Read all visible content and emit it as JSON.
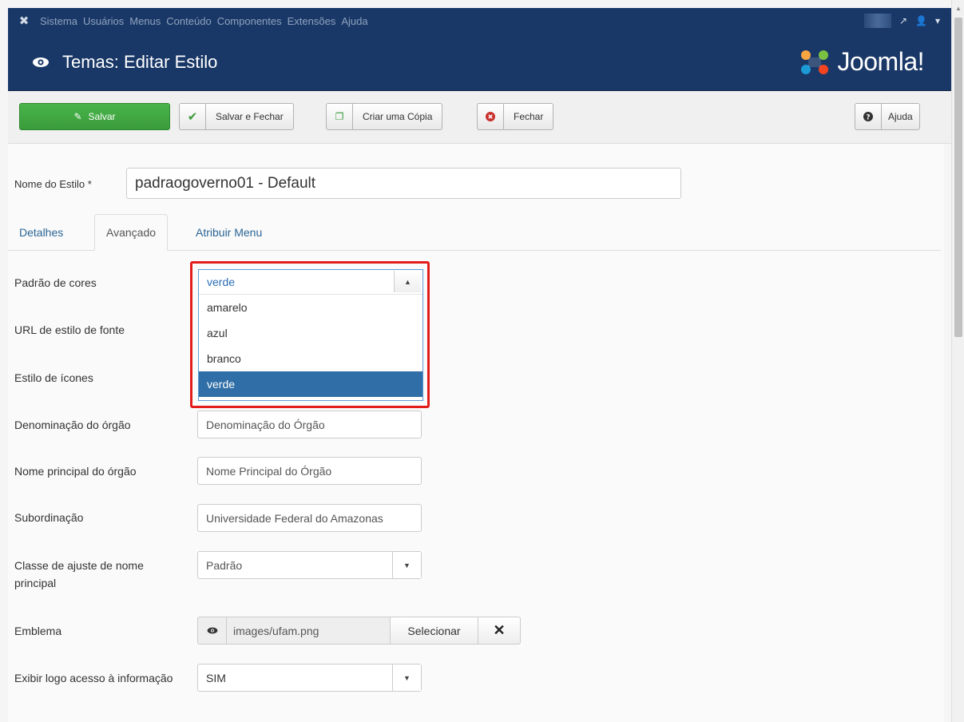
{
  "topnav": {
    "menu": [
      "Sistema",
      "Usuários",
      "Menus",
      "Conteúdo",
      "Componentes",
      "Extensões",
      "Ajuda"
    ],
    "user_caret": "▾"
  },
  "header": {
    "title": "Temas: Editar Estilo",
    "brand": "Joomla!"
  },
  "toolbar": {
    "save": "Salvar",
    "save_close": "Salvar e Fechar",
    "copy": "Criar uma Cópia",
    "close": "Fechar",
    "help": "Ajuda"
  },
  "style_name": {
    "label": "Nome do Estilo *",
    "value": "padraogoverno01 - Default"
  },
  "tabs": {
    "details": "Detalhes",
    "advanced": "Avançado",
    "assign_menu": "Atribuir Menu"
  },
  "fields": {
    "color_pattern": "Padrão de cores",
    "font_url": "URL de estilo de fonte",
    "icon_style": "Estilo de ícones",
    "org_name": "Denominação do órgão",
    "org_main_name": "Nome principal do órgão",
    "subordination": "Subordinação",
    "name_class": "Classe de ajuste de nome principal",
    "emblem": "Emblema",
    "show_logo": "Exibir logo acesso à informação"
  },
  "color_dropdown": {
    "selected": "verde",
    "options": [
      "amarelo",
      "azul",
      "branco",
      "verde"
    ]
  },
  "values": {
    "org_name_placeholder": "Denominação do Órgão",
    "org_main_name_placeholder": "Nome Principal do Órgão",
    "subordination": "Universidade Federal do Amazonas",
    "name_class": "Padrão",
    "emblem_path": "images/ufam.png",
    "emblem_select": "Selecionar",
    "emblem_clear": "✕",
    "show_logo": "SIM"
  },
  "colors": {
    "nav": "#1a3867",
    "save_green": "#3fa441",
    "highlight_red": "#e31b1b",
    "selected_blue": "#2f6ea6"
  }
}
